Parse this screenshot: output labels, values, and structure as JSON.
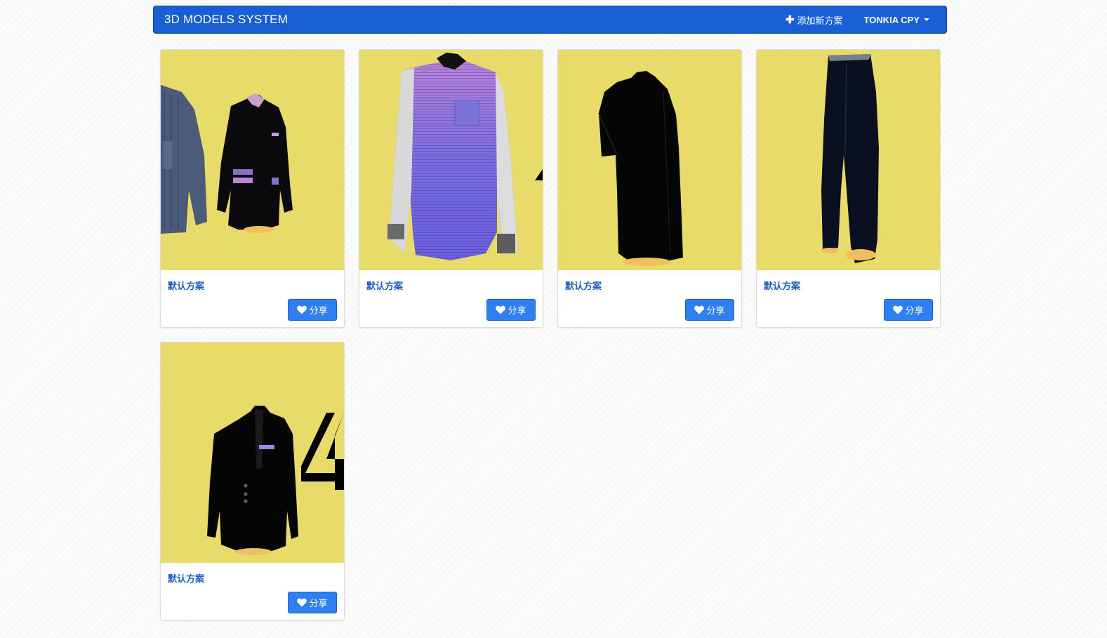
{
  "navbar": {
    "brand": "3D MODELS SYSTEM",
    "add_label": "添加新方案",
    "user_label": "TONKIA CPY",
    "background": "#175fd3"
  },
  "cards": [
    {
      "title": "默认方案",
      "share_label": "分享",
      "garment": "suit-jacket-with-shirt"
    },
    {
      "title": "默认方案",
      "share_label": "分享",
      "garment": "striped-shirt"
    },
    {
      "title": "默认方案",
      "share_label": "分享",
      "garment": "black-shirt"
    },
    {
      "title": "默认方案",
      "share_label": "分享",
      "garment": "black-trousers"
    },
    {
      "title": "默认方案",
      "share_label": "分享",
      "garment": "black-suit-jacket"
    }
  ],
  "colors": {
    "thumb_background": "#e9db69",
    "share_button": "#2f7ff0",
    "card_title": "#1d5fc4"
  }
}
